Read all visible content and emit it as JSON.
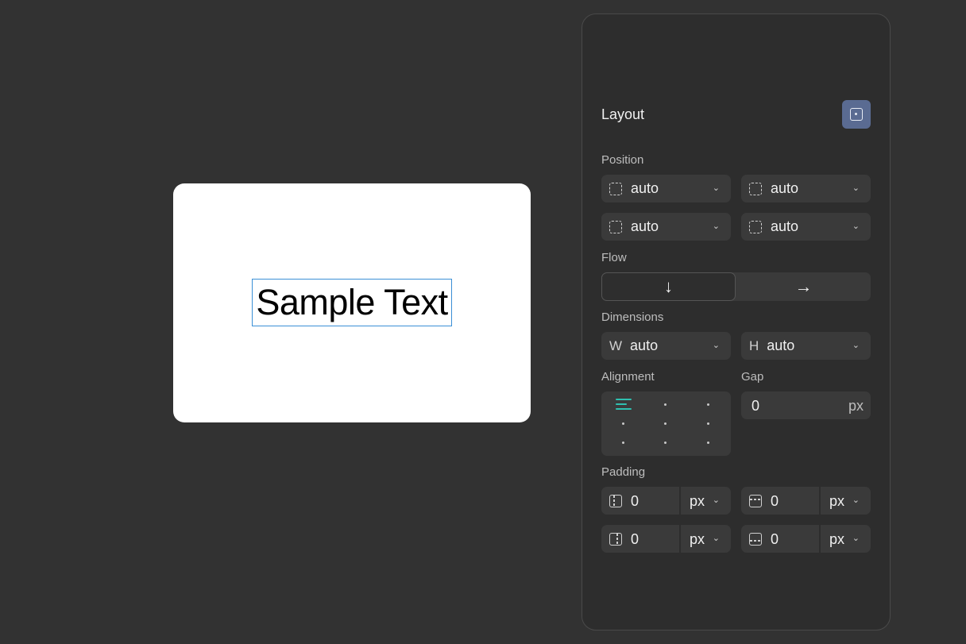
{
  "canvas": {
    "sample_text": "Sample Text"
  },
  "panel": {
    "title": "Layout",
    "layout_toggle_icon": "layout-center-icon",
    "position": {
      "label": "Position",
      "fields": [
        "auto",
        "auto",
        "auto",
        "auto"
      ]
    },
    "flow": {
      "label": "Flow",
      "options": [
        "↓",
        "→"
      ],
      "selected": "↓"
    },
    "dimensions": {
      "label": "Dimensions",
      "width_prefix": "W",
      "width_value": "auto",
      "height_prefix": "H",
      "height_value": "auto"
    },
    "alignment": {
      "label": "Alignment",
      "selected": "top-left",
      "active_color": "#2fc0b0"
    },
    "gap": {
      "label": "Gap",
      "value": "0",
      "unit": "px"
    },
    "padding": {
      "label": "Padding",
      "left": {
        "value": "0",
        "unit": "px"
      },
      "top": {
        "value": "0",
        "unit": "px"
      },
      "right": {
        "value": "0",
        "unit": "px"
      },
      "bottom": {
        "value": "0",
        "unit": "px"
      }
    }
  }
}
